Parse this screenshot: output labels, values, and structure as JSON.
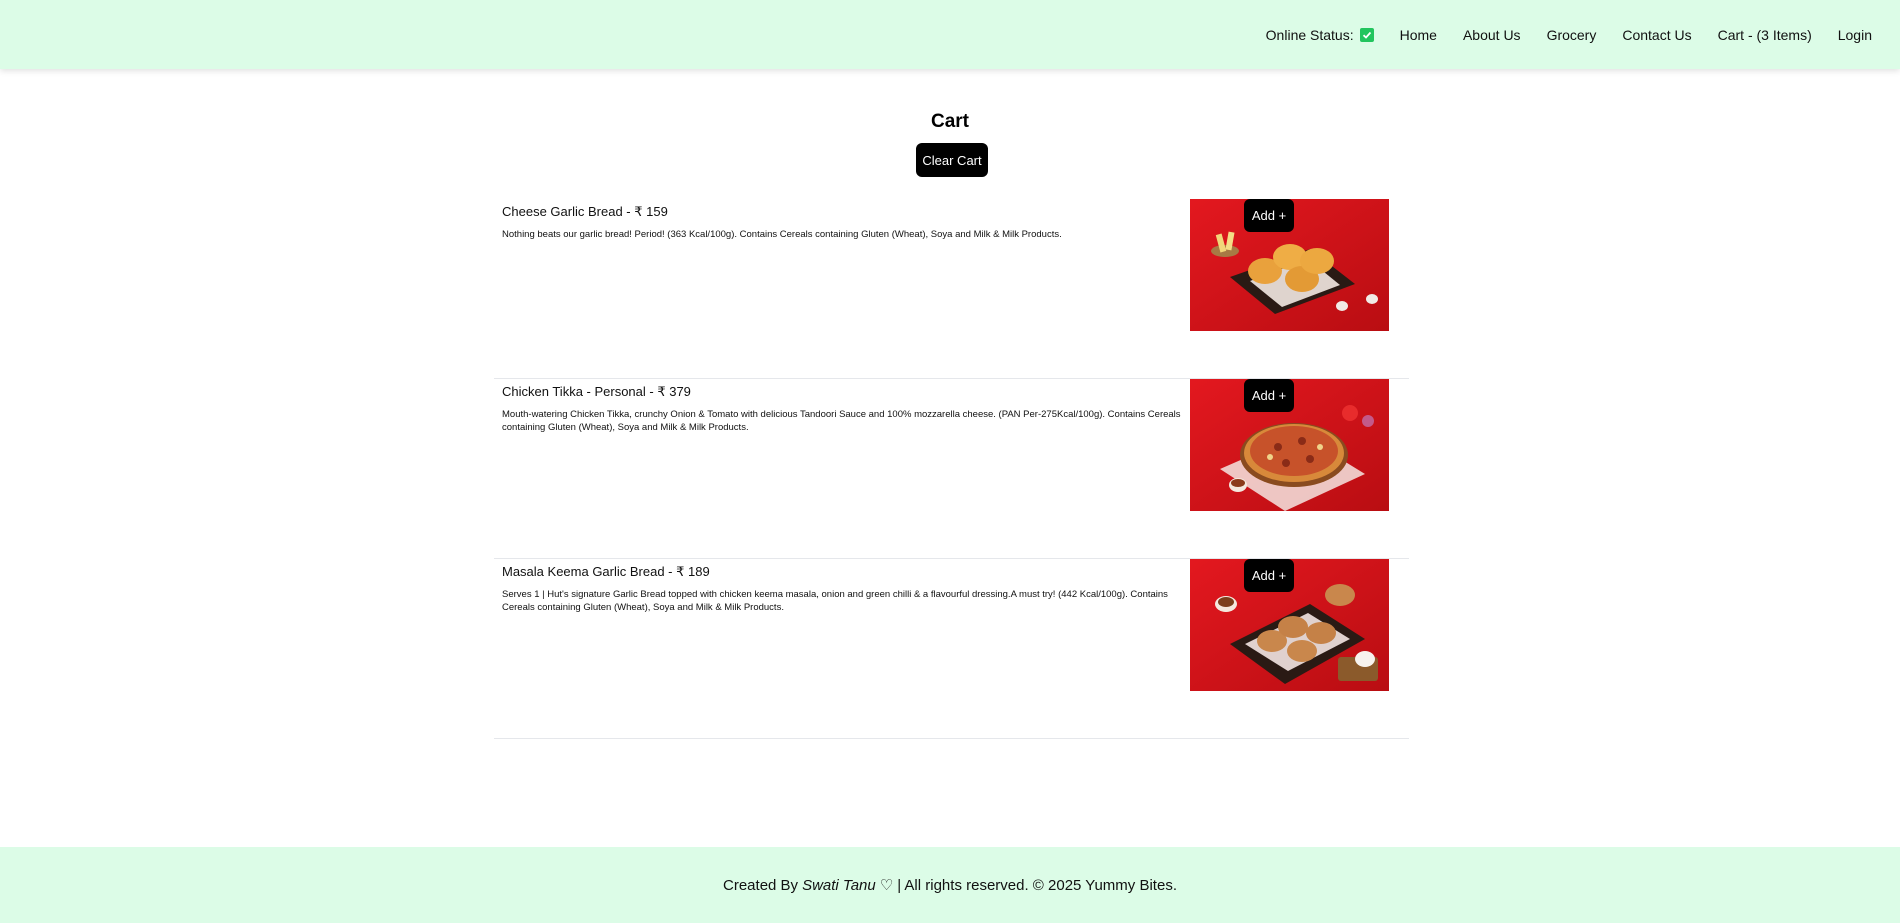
{
  "header": {
    "online_status_label": "Online Status:",
    "online_status_icon": "green-checkbox-icon",
    "nav": [
      {
        "label": "Home"
      },
      {
        "label": "About Us"
      },
      {
        "label": "Grocery"
      },
      {
        "label": "Contact Us"
      },
      {
        "label": "Cart - (3 Items)"
      },
      {
        "label": "Login"
      }
    ]
  },
  "cart": {
    "title": "Cart",
    "clear_label": "Clear Cart",
    "items": [
      {
        "name": "Cheese Garlic Bread - ₹ 159",
        "description": "Nothing beats our garlic bread! Period! (363 Kcal/100g). Contains Cereals containing Gluten (Wheat), Soya and Milk & Milk Products.",
        "add_label": "Add +",
        "image": "garlic-bread-photo"
      },
      {
        "name": "Chicken Tikka - Personal - ₹ 379",
        "description": "Mouth-watering Chicken Tikka, crunchy Onion & Tomato with delicious Tandoori Sauce and 100% mozzarella cheese. (PAN Per-275Kcal/100g). Contains Cereals containing Gluten (Wheat), Soya and Milk & Milk Products.",
        "add_label": "Add +",
        "image": "chicken-tikka-pizza-photo"
      },
      {
        "name": "Masala Keema Garlic Bread - ₹ 189",
        "description": "Serves 1 | Hut's signature Garlic Bread topped with chicken keema masala, onion and green chilli & a flavourful dressing.A must try! (442 Kcal/100g). Contains Cereals containing Gluten (Wheat), Soya and Milk & Milk Products.",
        "add_label": "Add +",
        "image": "masala-keema-garlic-bread-photo"
      }
    ]
  },
  "footer": {
    "prefix": "Created By",
    "author": "Swati Tanu",
    "heart": "♡",
    "suffix": "| All rights reserved. © 2025 Yummy Bites."
  },
  "colors": {
    "header_bg": "#dcfce7",
    "footer_bg": "#dcfce7",
    "button_bg": "#000000",
    "status_green": "#22c55e",
    "image_red": "#d7141a"
  }
}
